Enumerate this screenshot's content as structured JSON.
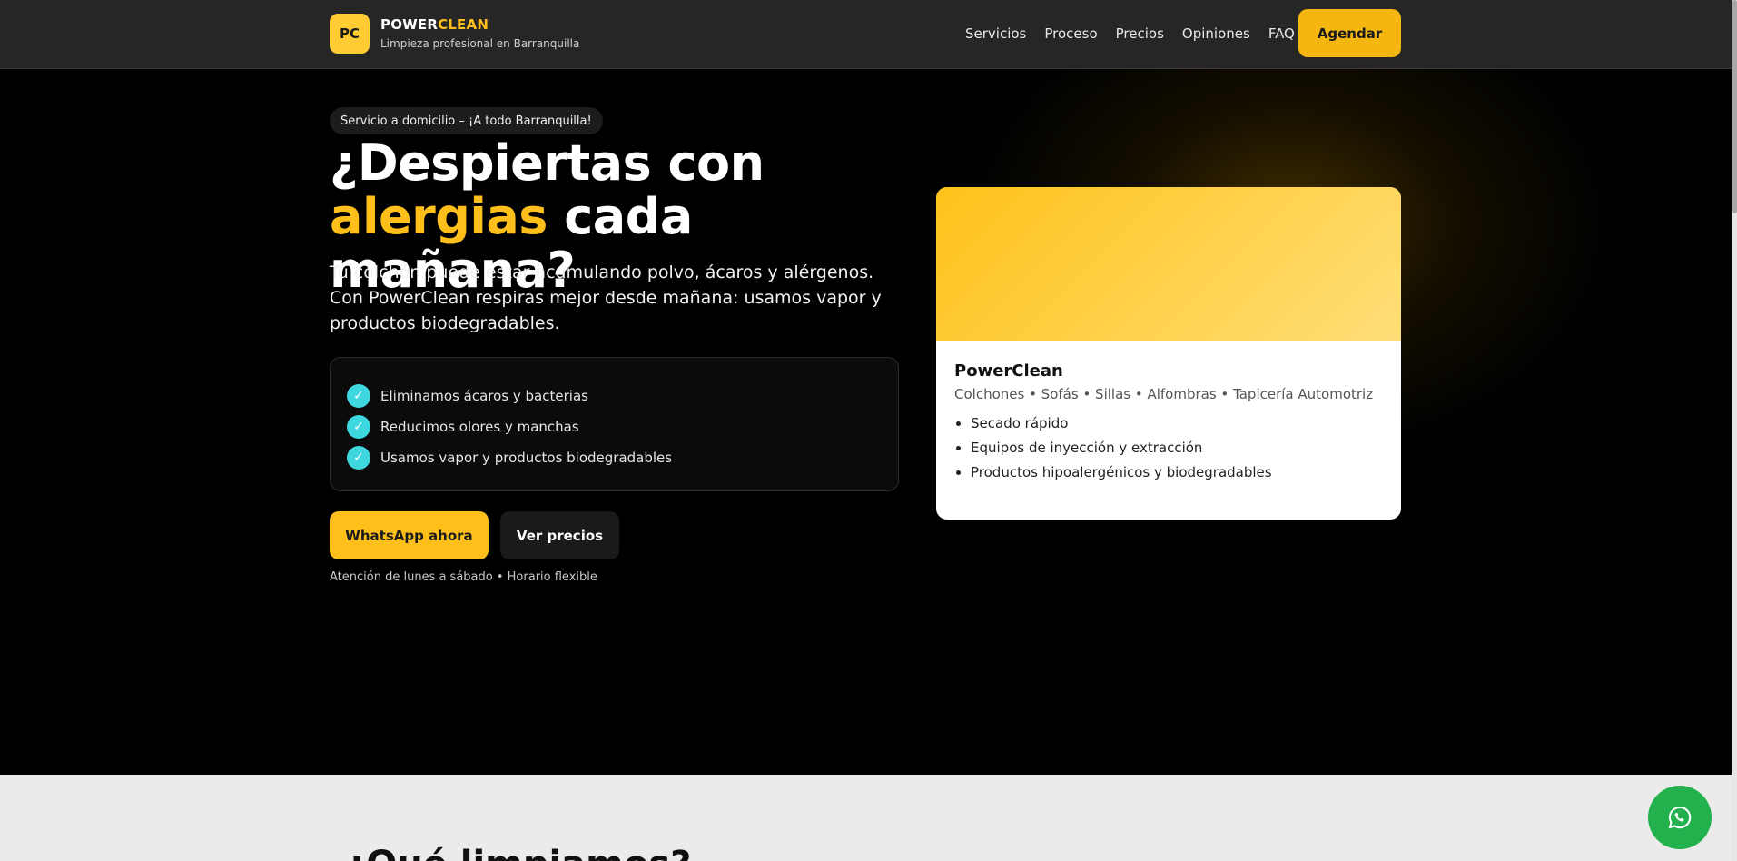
{
  "nav": {
    "logo": "PC",
    "brand_part1": "POWER",
    "brand_part2": "CLEAN",
    "tagline": "Limpieza profesional en Barranquilla",
    "links": [
      "Servicios",
      "Proceso",
      "Precios",
      "Opiniones",
      "FAQ"
    ],
    "cta": "Agendar"
  },
  "hero": {
    "pill": "Servicio a domicilio – ¡A todo Barranquilla!",
    "title_line1": "¿Despiertas con",
    "title_highlight": "alergias",
    "title_line2_rest": " cada mañana?",
    "lead": "Tu colchón puede estar acumulando polvo, ácaros y alérgenos. Con PowerClean respiras mejor desde mañana: usamos vapor y productos biodegradables.",
    "checks": [
      "Eliminamos ácaros y bacterias",
      "Reducimos olores y manchas",
      "Usamos vapor y productos biodegradables"
    ],
    "check_icon": "check-icon",
    "btn_whatsapp": "WhatsApp ahora",
    "btn_prices": "Ver precios",
    "hours": "Atención de lunes a sábado • Horario flexible"
  },
  "card": {
    "title": "PowerClean",
    "subtitle": "Colchones • Sofás • Sillas • Alfombras • Tapicería Automotriz",
    "items": [
      "Secado rápido",
      "Equipos de inyección y extracción",
      "Productos hipoalergénicos y biodegradables"
    ]
  },
  "section2": {
    "title": "¿Qué limpiamos?"
  },
  "colors": {
    "accent": "#ffbf1a",
    "check": "#3ed6df",
    "whatsapp": "#22b14c"
  }
}
